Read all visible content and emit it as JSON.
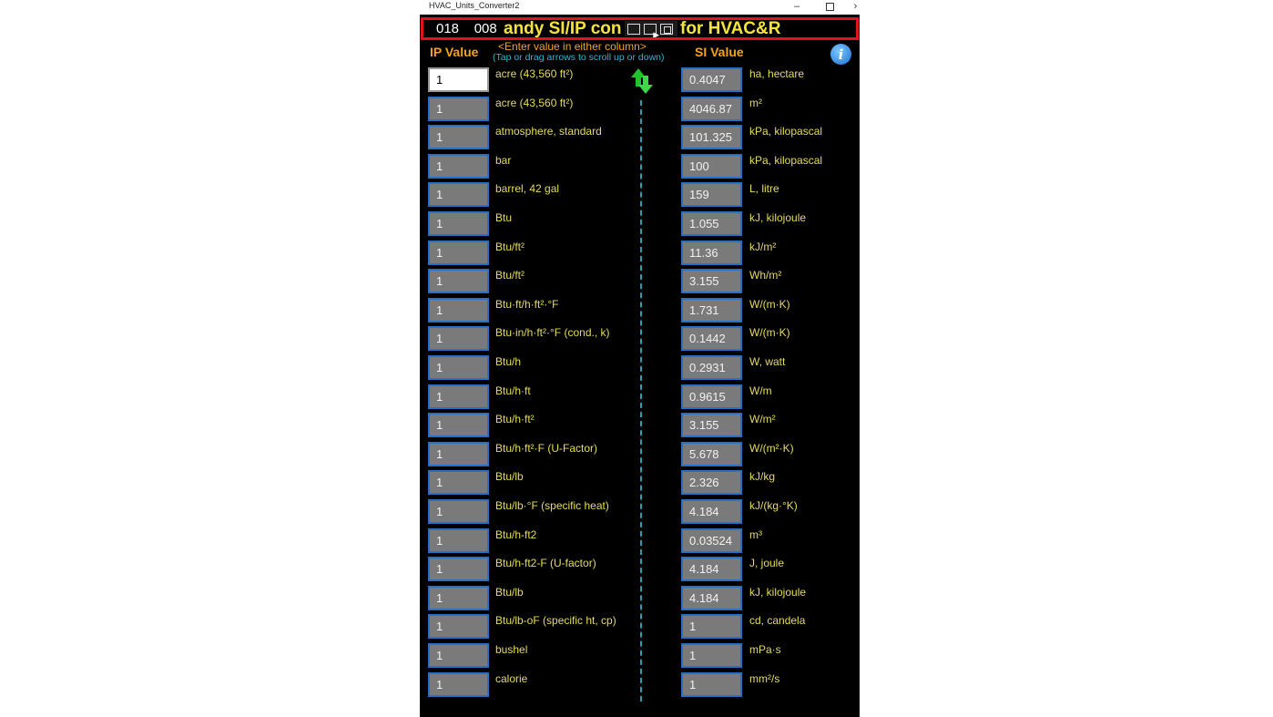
{
  "window": {
    "title": "HVAC_Units_Converter2",
    "controls": {
      "minimize": "–",
      "close": "›"
    }
  },
  "banner": {
    "left_numbers": "018    008",
    "text": "andy SI/IP con",
    "text_right": "for HVAC&R"
  },
  "headers": {
    "ip": "IP Value",
    "si": "SI Value",
    "hint": "<Enter value in either column>",
    "subhint": "(Tap or drag arrows to scroll up or down)"
  },
  "icons": {
    "info": "info-icon",
    "scroll": "scroll-arrows-icon"
  },
  "colors": {
    "banner_border": "#e0141a",
    "banner_text": "#f6e43a",
    "header_orange": "#f5a21c",
    "hint_cyan": "#29b8d8",
    "field_border": "#2770c6",
    "label_yellow": "#e6dc5a"
  },
  "rows": [
    {
      "ip_value": "1",
      "ip_unit": "acre (43,560 ft²)",
      "si_value": "0.4047",
      "si_unit": "ha, hectare"
    },
    {
      "ip_value": "1",
      "ip_unit": "acre (43,560 ft²)",
      "si_value": "4046.87",
      "si_unit": "m²"
    },
    {
      "ip_value": "1",
      "ip_unit": "atmosphere, standard",
      "si_value": "101.325",
      "si_unit": "kPa, kilopascal"
    },
    {
      "ip_value": "1",
      "ip_unit": "bar",
      "si_value": "100",
      "si_unit": "kPa, kilopascal"
    },
    {
      "ip_value": "1",
      "ip_unit": "barrel, 42 gal",
      "si_value": "159",
      "si_unit": "L, litre"
    },
    {
      "ip_value": "1",
      "ip_unit": "Btu",
      "si_value": "1.055",
      "si_unit": "kJ, kilojoule"
    },
    {
      "ip_value": "1",
      "ip_unit": "Btu/ft²",
      "si_value": "11.36",
      "si_unit": "kJ/m²"
    },
    {
      "ip_value": "1",
      "ip_unit": "Btu/ft²",
      "si_value": "3.155",
      "si_unit": "Wh/m²"
    },
    {
      "ip_value": "1",
      "ip_unit": "Btu·ft/h·ft²·°F",
      "si_value": "1.731",
      "si_unit": "W/(m·K)"
    },
    {
      "ip_value": "1",
      "ip_unit": "Btu·in/h·ft²·°F (cond., k)",
      "si_value": "0.1442",
      "si_unit": "W/(m·K)"
    },
    {
      "ip_value": "1",
      "ip_unit": "Btu/h",
      "si_value": "0.2931",
      "si_unit": "W, watt"
    },
    {
      "ip_value": "1",
      "ip_unit": "Btu/h·ft",
      "si_value": "0.9615",
      "si_unit": "W/m"
    },
    {
      "ip_value": "1",
      "ip_unit": "Btu/h·ft²",
      "si_value": "3.155",
      "si_unit": "W/m²"
    },
    {
      "ip_value": "1",
      "ip_unit": "Btu/h·ft²·F (U-Factor)",
      "si_value": "5.678",
      "si_unit": "W/(m²·K)"
    },
    {
      "ip_value": "1",
      "ip_unit": "Btu/lb",
      "si_value": "2.326",
      "si_unit": "kJ/kg"
    },
    {
      "ip_value": "1",
      "ip_unit": "Btu/lb·°F (specific heat)",
      "si_value": "4.184",
      "si_unit": "kJ/(kg·°K)"
    },
    {
      "ip_value": "1",
      "ip_unit": "Btu/h-ft2",
      "si_value": "0.03524",
      "si_unit": "m³"
    },
    {
      "ip_value": "1",
      "ip_unit": "Btu/h-ft2-F (U-factor)",
      "si_value": "4.184",
      "si_unit": "J, joule"
    },
    {
      "ip_value": "1",
      "ip_unit": "Btu/lb",
      "si_value": "4.184",
      "si_unit": "kJ, kilojoule"
    },
    {
      "ip_value": "1",
      "ip_unit": "Btu/lb-oF (specific ht, cp)",
      "si_value": "1",
      "si_unit": "cd, candela"
    },
    {
      "ip_value": "1",
      "ip_unit": "bushel",
      "si_value": "1",
      "si_unit": "mPa·s"
    },
    {
      "ip_value": "1",
      "ip_unit": "calorie",
      "si_value": "1",
      "si_unit": "mm²/s"
    }
  ]
}
